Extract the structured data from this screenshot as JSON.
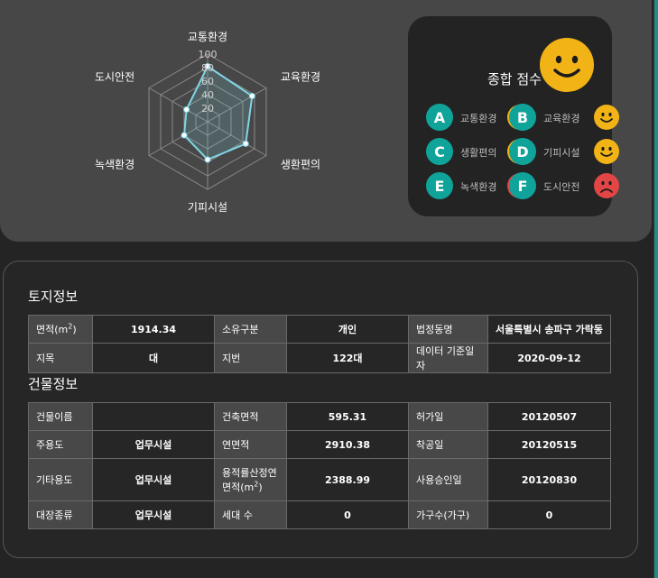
{
  "radar": {
    "axes": [
      "교통환경",
      "교육환경",
      "생환편의",
      "기피시설",
      "녹색환경",
      "도시안전"
    ],
    "ticks": [
      "100",
      "80",
      "60",
      "40",
      "20"
    ],
    "values": [
      82,
      76,
      65,
      56,
      40,
      36
    ],
    "max": 100
  },
  "score_card": {
    "title": "종합 점수",
    "overall_face": "happy-face-icon",
    "grades": [
      {
        "letter": "A",
        "label": "교통환경",
        "face": "happy",
        "color": "#f2b316"
      },
      {
        "letter": "B",
        "label": "교육환경",
        "face": "happy",
        "color": "#f2b316"
      },
      {
        "letter": "C",
        "label": "생활편의",
        "face": "happy",
        "color": "#f2b316"
      },
      {
        "letter": "D",
        "label": "기피시설",
        "face": "happy",
        "color": "#f2b316"
      },
      {
        "letter": "E",
        "label": "녹색환경",
        "face": "sad",
        "color": "#e24545"
      },
      {
        "letter": "F",
        "label": "도시안전",
        "face": "sad",
        "color": "#e24545"
      }
    ]
  },
  "land": {
    "title": "토지정보",
    "rows": [
      [
        "면적(m2)",
        "1914.34",
        "소유구분",
        "개인",
        "법정동명",
        "서울특별시 송파구 가락동"
      ],
      [
        "지목",
        "대",
        "지번",
        "122대",
        "데이터 기준일자",
        "2020-09-12"
      ]
    ]
  },
  "building": {
    "title": "건물정보",
    "rows": [
      [
        "건물이름",
        "",
        "건축면적",
        "595.31",
        "허가일",
        "20120507"
      ],
      [
        "주용도",
        "업무시설",
        "연면적",
        "2910.38",
        "착공일",
        "20120515"
      ],
      [
        "기타용도",
        "업무시설",
        "용적률산정연면적(m2)",
        "2388.99",
        "사용승인일",
        "20120830"
      ],
      [
        "대장종류",
        "업무시설",
        "세대 수",
        "0",
        "가구수(가구)",
        "0"
      ]
    ]
  },
  "colors": {
    "accent": "#0fa39a",
    "happy": "#f2b316",
    "sad": "#e24545",
    "radar_line": "#7fd6e6"
  }
}
